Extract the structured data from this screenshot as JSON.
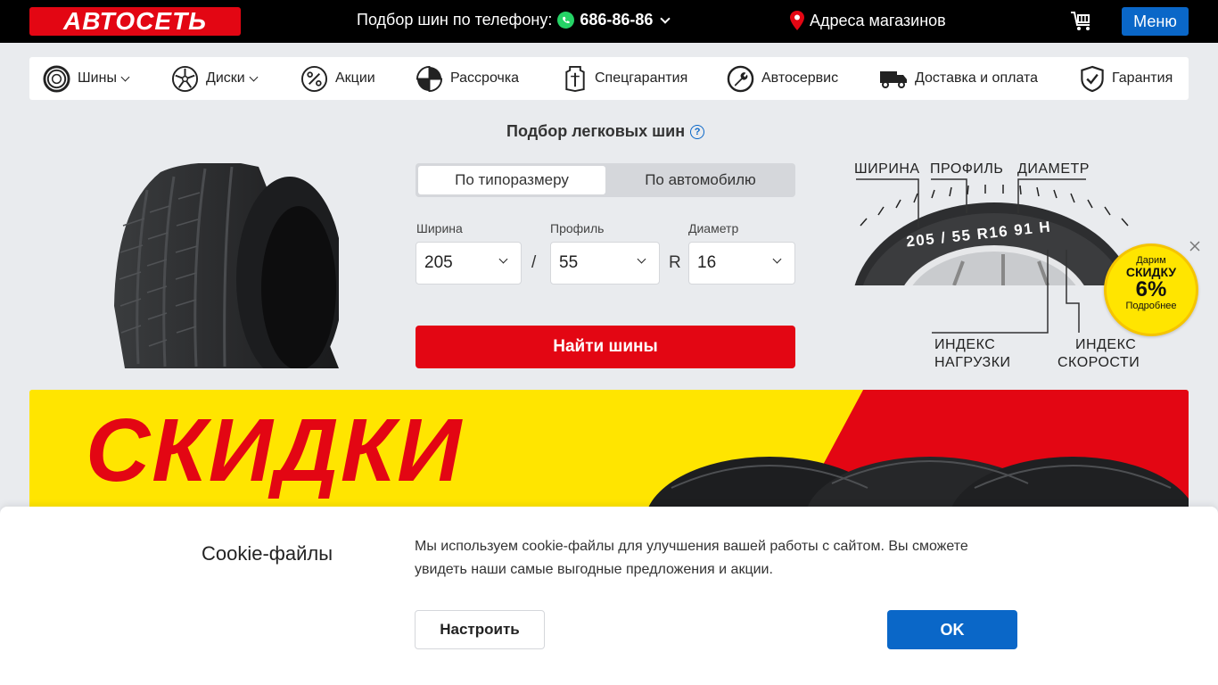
{
  "header": {
    "logo_text": "АВТОСЕТЬ",
    "phone_label": "Подбор шин по телефону:",
    "phone_number": "686-86-86",
    "stores_label": "Адреса магазинов",
    "menu_label": "Меню",
    "icons": [
      "whatsapp-icon",
      "location-pin-icon",
      "cart-icon"
    ]
  },
  "nav": {
    "items": [
      {
        "label": "Шины",
        "icon": "tire-icon",
        "dropdown": true
      },
      {
        "label": "Диски",
        "icon": "wheel-rim-icon",
        "dropdown": true
      },
      {
        "label": "Акции",
        "icon": "percent-icon",
        "dropdown": false
      },
      {
        "label": "Рассрочка",
        "icon": "pie-chart-icon",
        "dropdown": false
      },
      {
        "label": "Спецгарантия",
        "icon": "special-warranty-icon",
        "dropdown": false
      },
      {
        "label": "Автосервис",
        "icon": "wrench-icon",
        "dropdown": false
      },
      {
        "label": "Доставка и оплата",
        "icon": "truck-icon",
        "dropdown": false
      },
      {
        "label": "Гарантия",
        "icon": "shield-check-icon",
        "dropdown": false
      }
    ]
  },
  "selector": {
    "title": "Подбор легковых шин",
    "help": "?",
    "tabs": [
      {
        "label": "По типоразмеру",
        "active": true
      },
      {
        "label": "По автомобилю",
        "active": false
      }
    ],
    "width_label": "Ширина",
    "width_value": "205",
    "profile_label": "Профиль",
    "profile_value": "55",
    "diameter_label": "Диаметр",
    "diameter_value": "16",
    "separator_slash": "/",
    "separator_r": "R",
    "find_button": "Найти шины"
  },
  "diagram": {
    "width_label": "ШИРИНА",
    "profile_label": "ПРОФИЛЬ",
    "diameter_label": "ДИАМЕТР",
    "sidewall_text": "205 / 55  R16  91 H",
    "load_index_label_1": "ИНДЕКС",
    "load_index_label_2": "НАГРУЗКИ",
    "speed_index_label_1": "ИНДЕКС",
    "speed_index_label_2": "СКОРОСТИ"
  },
  "badge": {
    "line1": "Дарим",
    "line2": "СКИДКУ",
    "line3": "6%",
    "line4": "Подробнее"
  },
  "banner": {
    "text": "СКИДКИ",
    "colors": {
      "background": "#ffe500",
      "text": "#e30613"
    }
  },
  "cookie": {
    "title": "Cookie-файлы",
    "text": "Мы используем cookie-файлы для улучшения вашей работы с сайтом. Вы сможете увидеть наши самые выгодные предложения и акции.",
    "configure_button": "Настроить",
    "ok_button": "OK"
  },
  "colors": {
    "brand_red": "#e30613",
    "accent_blue": "#0a67c8",
    "header_bg": "#000000",
    "page_bg": "#e9ebee"
  }
}
